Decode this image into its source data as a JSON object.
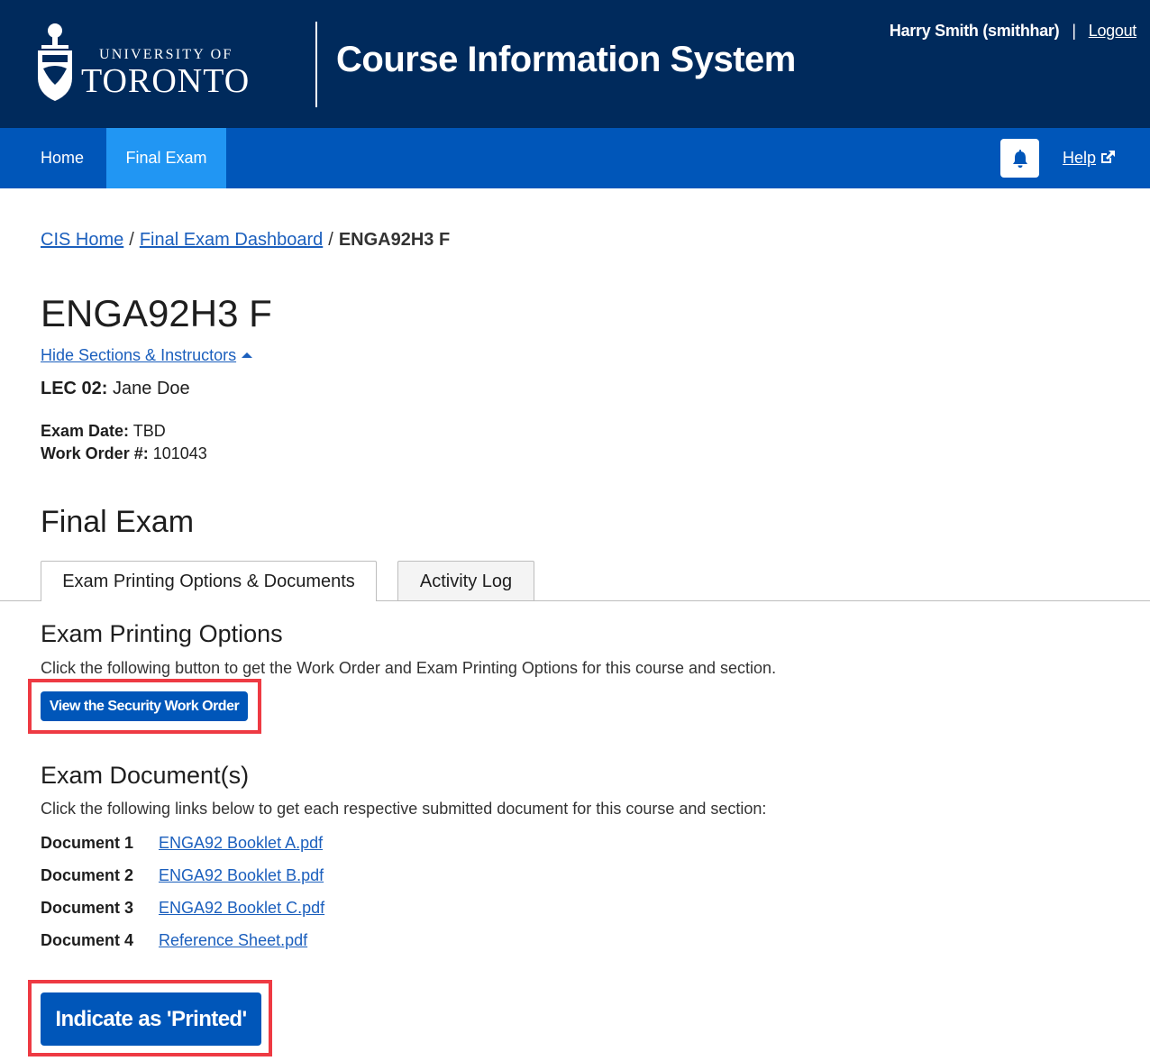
{
  "header": {
    "logo_line1": "UNIVERSITY OF",
    "logo_line2": "TORONTO",
    "app_title": "Course Information System",
    "user_name": "Harry Smith (smithhar)",
    "separator": "|",
    "logout_label": "Logout"
  },
  "nav": {
    "items": [
      {
        "label": "Home"
      },
      {
        "label": "Final Exam"
      }
    ],
    "help_label": "Help",
    "bell_icon": "bell-icon",
    "external_icon": "external-link-icon"
  },
  "breadcrumb": {
    "items": [
      {
        "label": "CIS Home"
      },
      {
        "label": "Final Exam Dashboard"
      }
    ],
    "separator": "/",
    "current": "ENGA92H3 F"
  },
  "course": {
    "title": "ENGA92H3 F",
    "toggle_label": "Hide Sections & Instructors",
    "lecture_label": "LEC 02:",
    "lecture_instructor": "Jane Doe",
    "exam_date_label": "Exam Date:",
    "exam_date_value": "TBD",
    "work_order_label": "Work Order #:",
    "work_order_value": "101043"
  },
  "final_exam": {
    "heading": "Final Exam",
    "tabs": [
      {
        "label": "Exam Printing Options & Documents",
        "active": true
      },
      {
        "label": "Activity Log",
        "active": false
      }
    ],
    "printing_heading": "Exam Printing Options",
    "printing_text": "Click the following button to get the Work Order and Exam Printing Options for this course and section.",
    "security_button": "View the Security Work Order",
    "documents_heading": "Exam Document(s)",
    "documents_text": "Click the following links below to get each respective submitted document for this course and section:",
    "documents": [
      {
        "label": "Document 1",
        "file": "ENGA92 Booklet A.pdf"
      },
      {
        "label": "Document 2",
        "file": "ENGA92 Booklet B.pdf"
      },
      {
        "label": "Document 3",
        "file": "ENGA92 Booklet C.pdf"
      },
      {
        "label": "Document 4",
        "file": "Reference Sheet.pdf"
      }
    ],
    "printed_button": "Indicate as 'Printed'"
  },
  "colors": {
    "header_bg": "#002a5c",
    "nav_bg": "#0056b9",
    "nav_active_bg": "#2196f3",
    "link": "#1b5fbd",
    "highlight": "#ee3a43"
  }
}
